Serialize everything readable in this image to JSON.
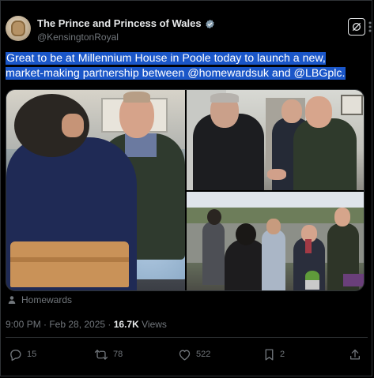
{
  "account": {
    "display_name": "The Prince and Princess of Wales",
    "handle": "@KensingtonRoyal"
  },
  "tweet": {
    "text": "Great to be at Millennium House in Poole today to launch a new, market-making partnership between @homewardsuk and @LBGplc.",
    "location_tag": "Homewards",
    "timestamp": "9:00 PM · Feb 28, 2025 · ",
    "views_count": "16.7K",
    "views_label": " Views"
  },
  "actions": {
    "replies": "15",
    "reposts": "78",
    "likes": "522",
    "bookmarks": "2"
  },
  "colors": {
    "background": "#000000",
    "text_primary": "#e7e9ea",
    "text_secondary": "#71767b",
    "selection_highlight": "#1a56c8",
    "verified_badge": "#829aab"
  },
  "icons": {
    "verified": "verified-badge-icon",
    "grok": "grok-icon",
    "location": "person-icon",
    "reply": "reply-icon",
    "repost": "repost-icon",
    "like": "heart-icon",
    "bookmark": "bookmark-icon",
    "share": "share-icon"
  }
}
